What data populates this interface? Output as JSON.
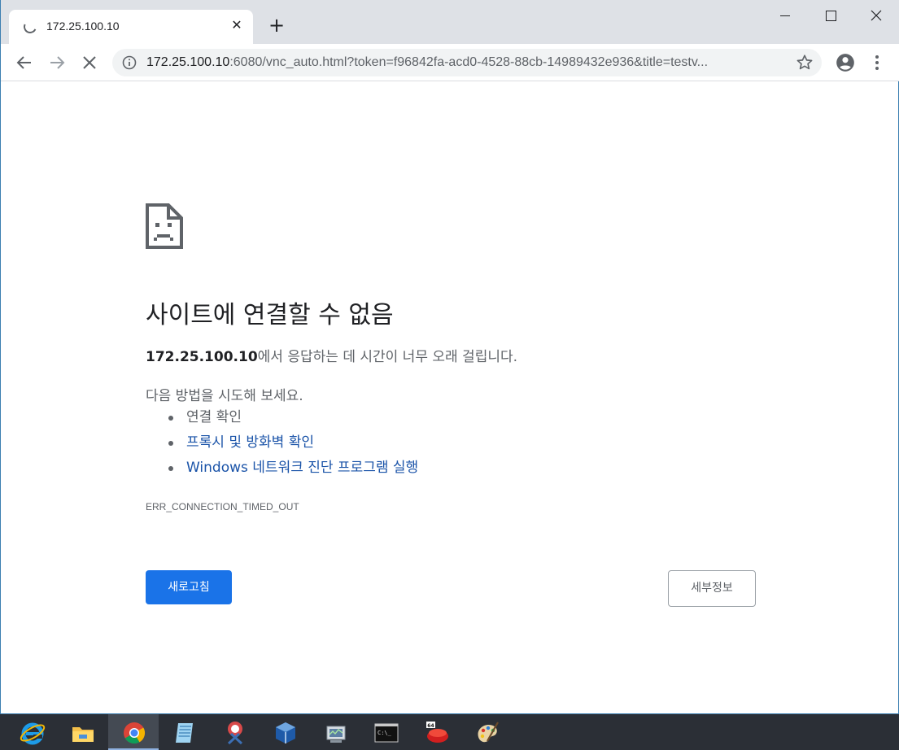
{
  "tab": {
    "title": "172.25.100.10"
  },
  "omnibox": {
    "url_host": "172.25.100.10",
    "url_rest": ":6080/vnc_auto.html?token=f96842fa-acd0-4528-88cb-14989432e936&title=testv..."
  },
  "error_page": {
    "heading": "사이트에 연결할 수 없음",
    "host": "172.25.100.10",
    "description_suffix": "에서 응답하는 데 시간이 너무 오래 걸립니다.",
    "suggestions_intro": "다음 방법을 시도해 보세요.",
    "suggestions": [
      {
        "label": "연결 확인",
        "is_link": false
      },
      {
        "label": "프록시 및 방화벽 확인",
        "is_link": true
      },
      {
        "label": "Windows 네트워크 진단 프로그램 실행",
        "is_link": true
      }
    ],
    "error_code": "ERR_CONNECTION_TIMED_OUT",
    "reload_label": "새로고침",
    "details_label": "세부정보"
  },
  "colors": {
    "accent": "#1a73e8",
    "link": "#1a53a8",
    "taskbar": "#2b2f36"
  },
  "taskbar": {
    "items": [
      {
        "icon": "internet-explorer-icon"
      },
      {
        "icon": "file-explorer-icon"
      },
      {
        "icon": "chrome-icon",
        "active": true
      },
      {
        "icon": "notepad-icon"
      },
      {
        "icon": "snipping-tool-icon"
      },
      {
        "icon": "virtualbox-icon"
      },
      {
        "icon": "network-monitor-icon"
      },
      {
        "icon": "command-prompt-icon"
      },
      {
        "icon": "app-64-icon"
      },
      {
        "icon": "paint-icon"
      }
    ]
  }
}
